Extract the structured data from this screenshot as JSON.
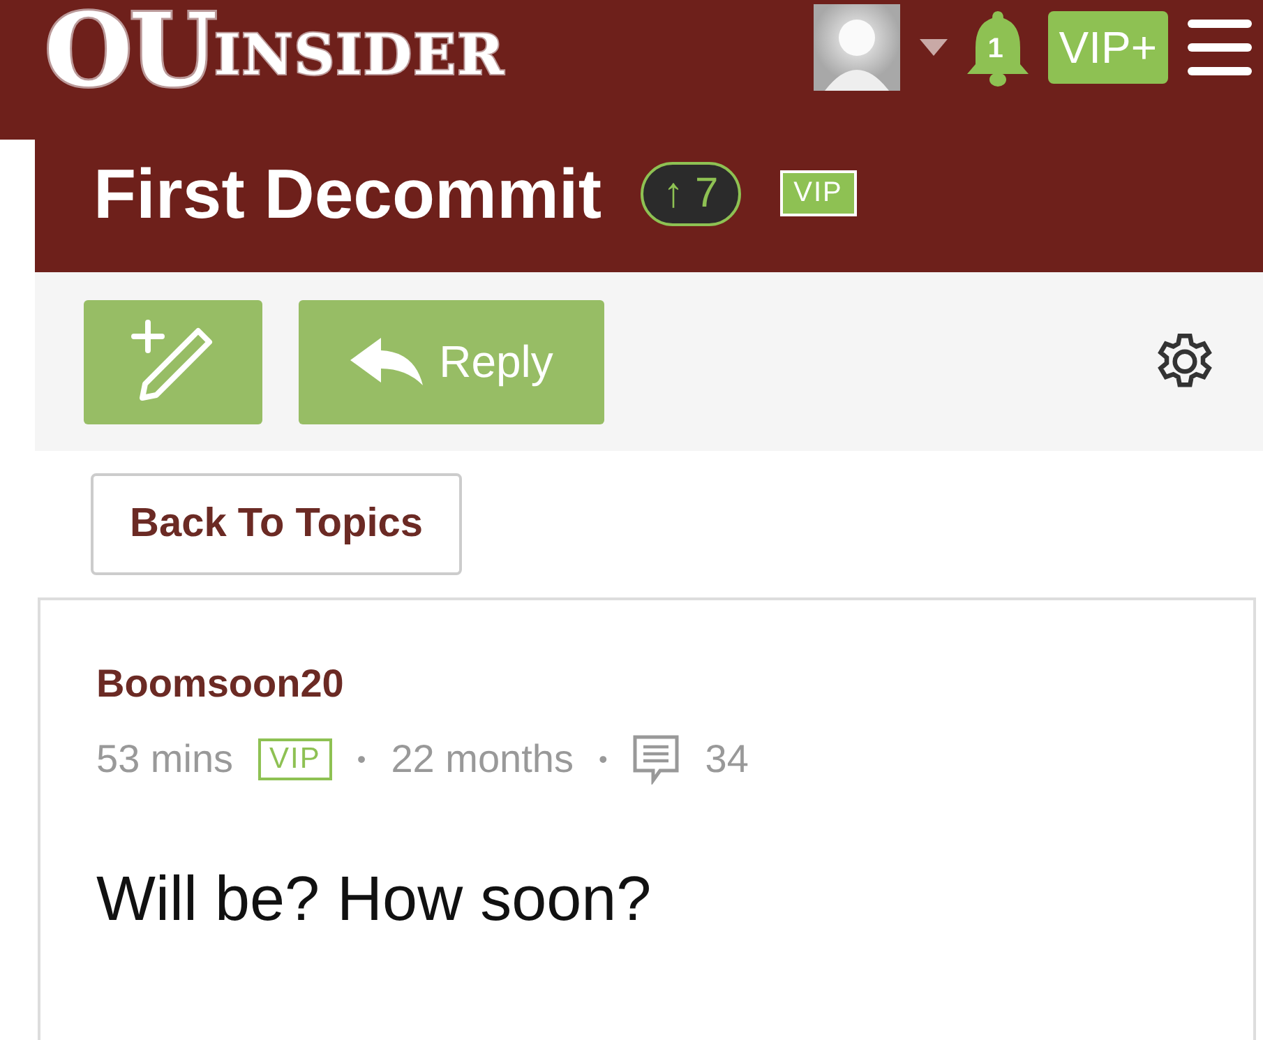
{
  "header": {
    "logo": {
      "mark": "OU",
      "name": "INSIDER"
    },
    "notification_count": "1",
    "vip_button": "VIP+"
  },
  "thread": {
    "title": "First Decommit",
    "upvote_arrow": "↑",
    "upvotes": "7",
    "badge": "VIP"
  },
  "toolbar": {
    "reply_button": "Reply"
  },
  "back_button": "Back To Topics",
  "post": {
    "author": "Boomsoon20",
    "time": "53 mins",
    "badge": "VIP",
    "separator_1": "•",
    "member_for": "22 months",
    "separator_2": "•",
    "post_count": "34",
    "body": "Will be? How soon?"
  }
}
